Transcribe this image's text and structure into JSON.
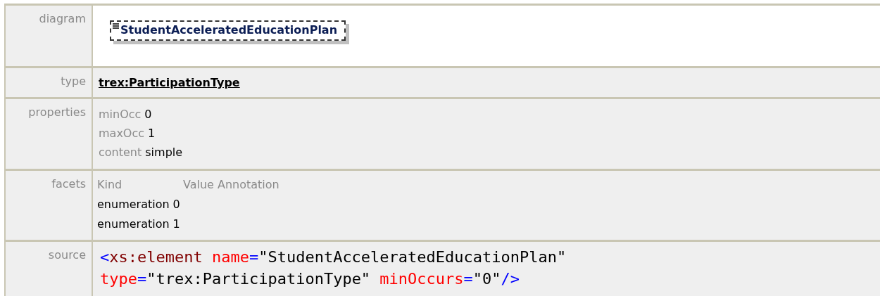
{
  "diagram": {
    "label": "diagram",
    "element": "StudentAcceleratedEducationPlan"
  },
  "type": {
    "label": "type",
    "value": "trex:ParticipationType"
  },
  "properties": {
    "label": "properties",
    "items": [
      {
        "name": "minOcc",
        "value": "0"
      },
      {
        "name": "maxOcc",
        "value": "1"
      },
      {
        "name": "content",
        "value": "simple"
      }
    ]
  },
  "facets": {
    "label": "facets",
    "columns": [
      "Kind",
      "Value",
      "Annotation"
    ],
    "rows": [
      {
        "kind": "enumeration",
        "value": "0"
      },
      {
        "kind": "enumeration",
        "value": "1"
      }
    ]
  },
  "source": {
    "label": "source",
    "lines": [
      [
        {
          "kind": "punct",
          "text": "<"
        },
        {
          "kind": "tag",
          "text": "xs:element"
        },
        {
          "kind": "attr",
          "text": "name",
          "spaced": true
        },
        {
          "kind": "punct",
          "text": "="
        },
        {
          "kind": "value",
          "text": "\"StudentAcceleratedEducationPlan\""
        }
      ],
      [
        {
          "kind": "attr",
          "text": "type"
        },
        {
          "kind": "punct",
          "text": "="
        },
        {
          "kind": "value",
          "text": "\"trex:ParticipationType\""
        },
        {
          "kind": "attr",
          "text": "minOccurs",
          "spaced": true
        },
        {
          "kind": "punct",
          "text": "="
        },
        {
          "kind": "value",
          "text": "\"0\""
        },
        {
          "kind": "punct",
          "text": "/>"
        }
      ]
    ]
  }
}
